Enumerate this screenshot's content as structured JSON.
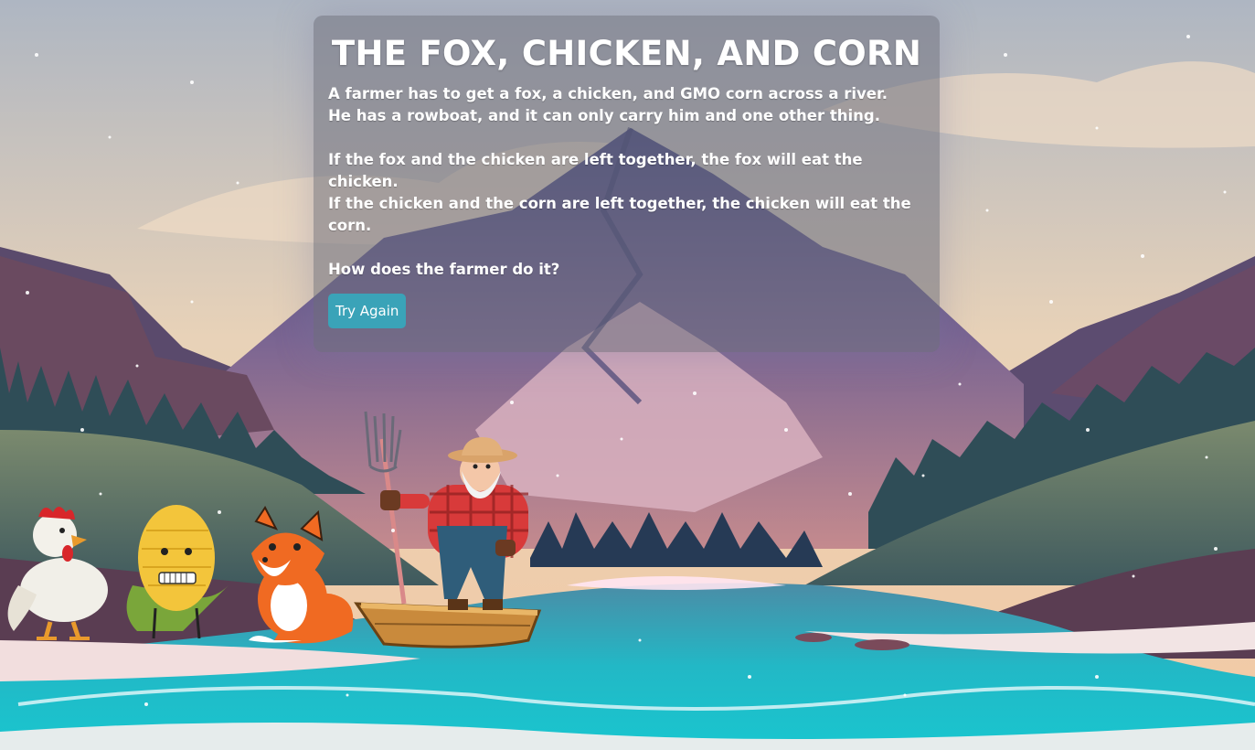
{
  "game": {
    "title": "THE FOX, CHICKEN, AND CORN",
    "story_lines": [
      "A farmer has to get a fox, a chicken, and GMO corn across a river.",
      "He has a rowboat, and it can only carry him and one other thing.",
      "",
      "If the fox and the chicken are left together, the fox will eat the chicken.",
      "If the chicken and the corn are left together, the chicken will eat the corn.",
      "",
      "How does the farmer do it?"
    ],
    "try_again_label": "Try Again"
  },
  "characters": [
    "chicken",
    "corn",
    "fox",
    "farmer",
    "rowboat"
  ],
  "colors": {
    "panel": "#6e707d",
    "button": "#3aa3b8",
    "river": "#22c2cc",
    "mountain": "#4a4a80"
  }
}
